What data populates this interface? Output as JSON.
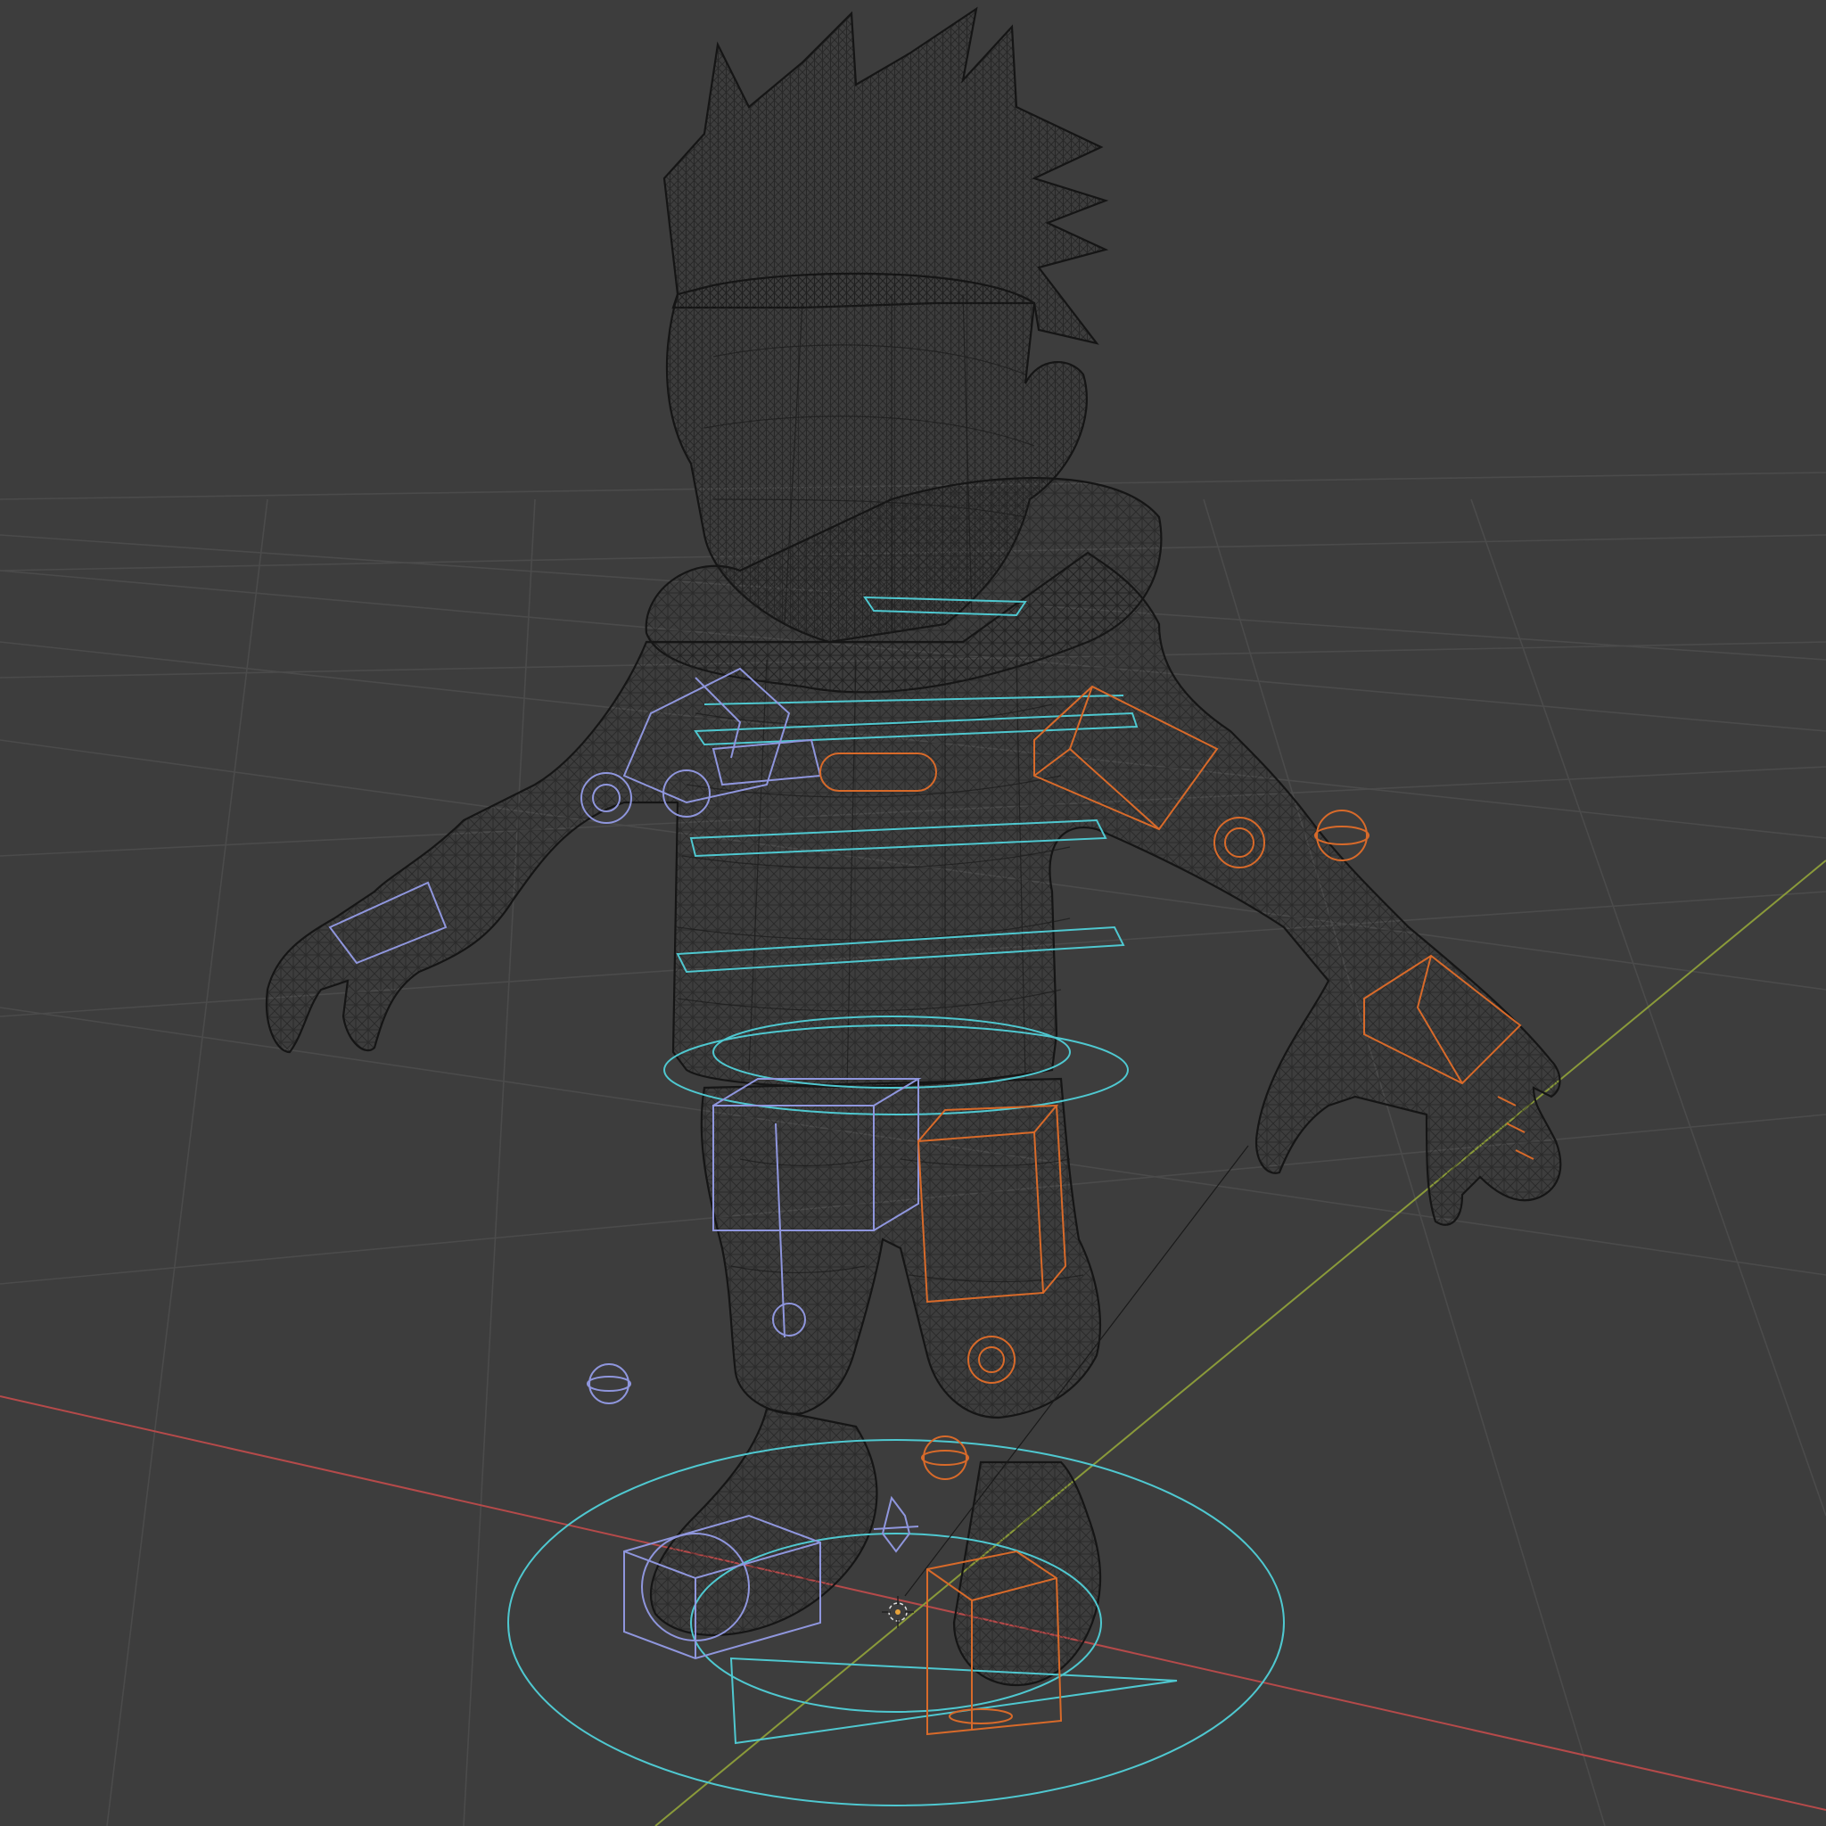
{
  "viewport": {
    "mode": "wireframe",
    "background_color": "#3d3d3d",
    "grid_color": "#4a4a4a",
    "mesh_color": "#1b1b1b",
    "x_axis_color": "#b54a4a",
    "y_axis_color": "#8a9a3a",
    "left_control_color": "#8f96dd",
    "right_control_color": "#d86a2a",
    "center_control_color": "#4fc8d0"
  },
  "scene": {
    "objects": [
      {
        "name": "character-mesh",
        "type": "mesh",
        "display": "wireframe"
      },
      {
        "name": "armature-controls",
        "type": "rig"
      }
    ],
    "origin_marker": "crosshair-icon"
  }
}
